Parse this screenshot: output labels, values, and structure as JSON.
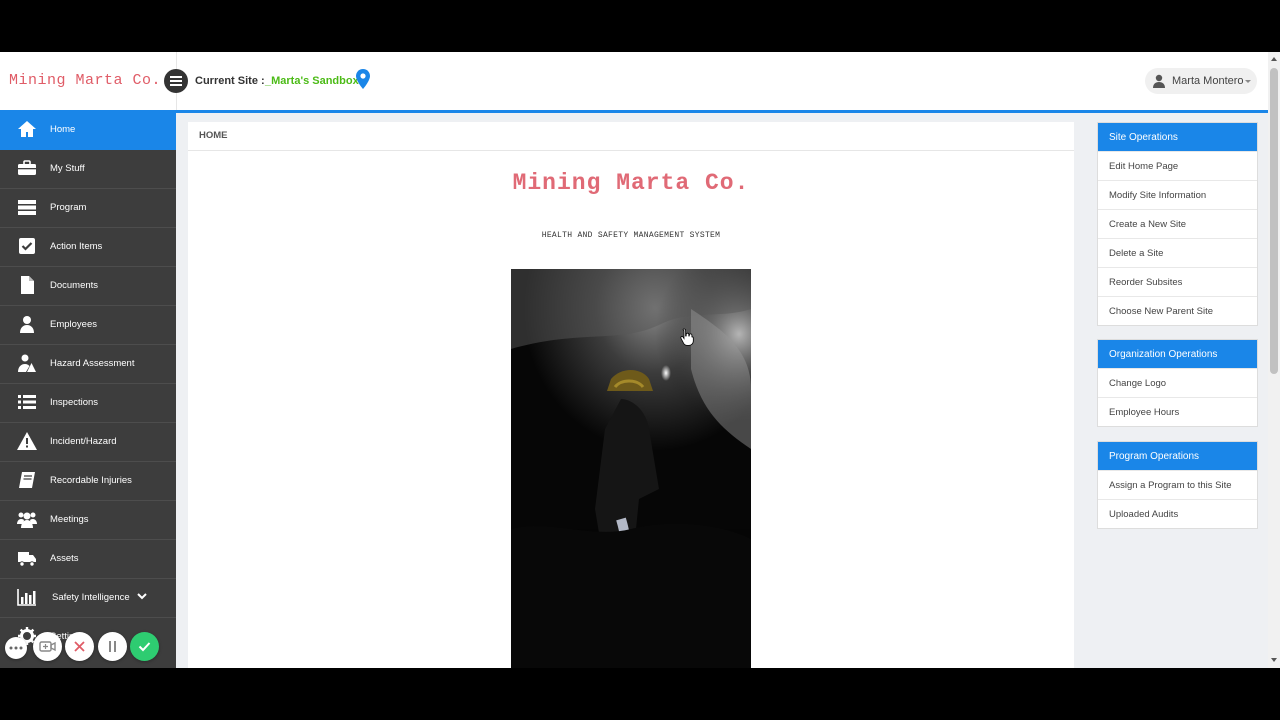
{
  "header": {
    "brand": "Mining Marta Co.",
    "current_site_label": "Current Site :",
    "current_site_value": "_Marta's Sandbox",
    "user_name": "Marta Montero"
  },
  "sidebar": {
    "items": [
      {
        "label": "Home",
        "icon": "home-icon"
      },
      {
        "label": "My Stuff",
        "icon": "briefcase-icon"
      },
      {
        "label": "Program",
        "icon": "server-icon"
      },
      {
        "label": "Action Items",
        "icon": "checkbox-icon"
      },
      {
        "label": "Documents",
        "icon": "file-icon"
      },
      {
        "label": "Employees",
        "icon": "user-icon"
      },
      {
        "label": "Hazard Assessment",
        "icon": "hazard-user-icon"
      },
      {
        "label": "Inspections",
        "icon": "list-icon"
      },
      {
        "label": "Incident/Hazard",
        "icon": "warning-icon"
      },
      {
        "label": "Recordable Injuries",
        "icon": "book-icon"
      },
      {
        "label": "Meetings",
        "icon": "group-icon"
      },
      {
        "label": "Assets",
        "icon": "truck-icon"
      },
      {
        "label": "Safety Intelligence",
        "icon": "bar-chart-icon"
      },
      {
        "label": "Settings",
        "icon": "gear-icon"
      }
    ],
    "active_index": 0
  },
  "main": {
    "breadcrumb": "HOME",
    "title": "Mining Marta Co.",
    "subtitle": "HEALTH AND SAFETY MANAGEMENT SYSTEM"
  },
  "right_panel": {
    "site_operations": {
      "title": "Site Operations",
      "items": [
        "Edit Home Page",
        "Modify Site Information",
        "Create a New Site",
        "Delete a Site",
        "Reorder Subsites",
        "Choose New Parent Site"
      ]
    },
    "organization_operations": {
      "title": "Organization Operations",
      "items": [
        "Change Logo",
        "Employee Hours"
      ]
    },
    "program_operations": {
      "title": "Program Operations",
      "items": [
        "Assign a Program to this Site",
        "Uploaded Audits"
      ]
    }
  },
  "colors": {
    "accent": "#1a86e8",
    "brand": "#e05c67",
    "sidebar": "#3d3d3d",
    "site_name": "#4cbb17",
    "confirm": "#2ecc71",
    "cancel": "#e05c67"
  }
}
